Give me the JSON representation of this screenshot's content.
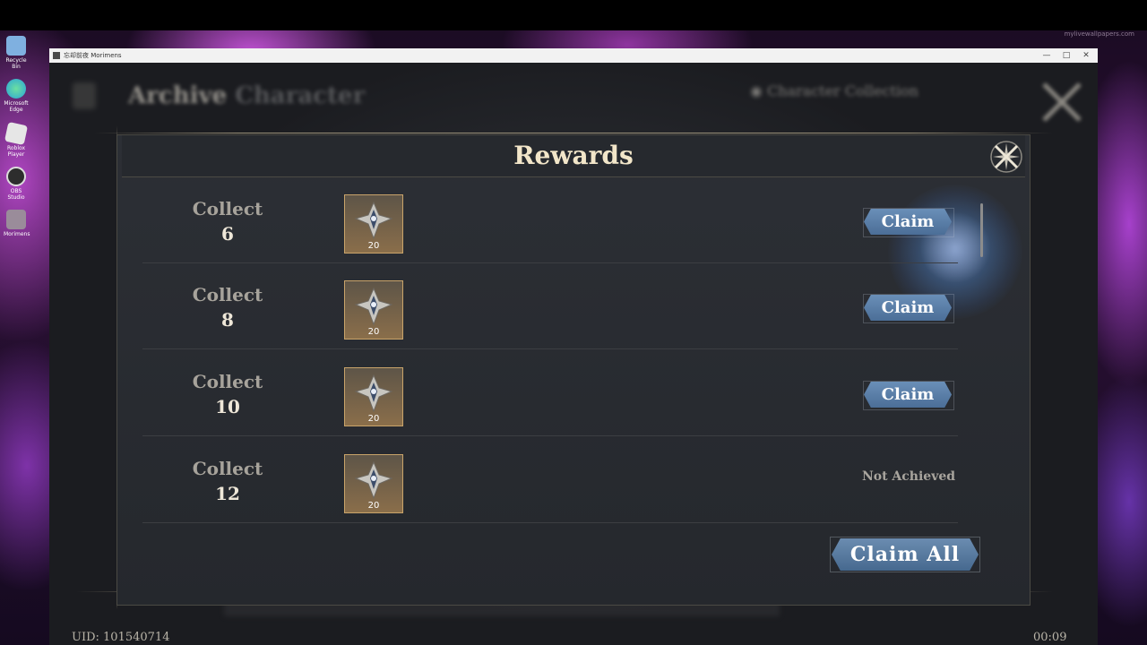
{
  "desktop": {
    "icons": [
      {
        "label": "Recycle Bin",
        "icon": "recycle-bin-icon",
        "color": "#7fb0e0"
      },
      {
        "label": "Microsoft Edge",
        "icon": "edge-icon",
        "color": "#2aa3d8"
      },
      {
        "label": "Roblox Player",
        "icon": "roblox-icon",
        "color": "#e6e6e6"
      },
      {
        "label": "OBS Studio",
        "icon": "obs-icon",
        "color": "#2d2d2d"
      },
      {
        "label": "Morimens",
        "icon": "morimens-icon",
        "color": "#9a8c9a"
      }
    ],
    "watermark": "mylivewallpapers.com"
  },
  "window": {
    "title": "忘却前夜 Morimens",
    "controls": {
      "minimize": "—",
      "maximize": "□",
      "close": "✕"
    }
  },
  "background_ui": {
    "title_main": "Archive",
    "title_sub": "Character",
    "collection_label": "Character Collection"
  },
  "dialog": {
    "title": "Rewards",
    "close_icon": "close-x-icon",
    "rows": [
      {
        "label": "Collect",
        "count": "6",
        "item_qty": "20",
        "action": "Claim",
        "state": "claimable"
      },
      {
        "label": "Collect",
        "count": "8",
        "item_qty": "20",
        "action": "Claim",
        "state": "claimable"
      },
      {
        "label": "Collect",
        "count": "10",
        "item_qty": "20",
        "action": "Claim",
        "state": "claimable"
      },
      {
        "label": "Collect",
        "count": "12",
        "item_qty": "20",
        "action": "Not Achieved",
        "state": "locked"
      }
    ],
    "claim_all": "Claim All"
  },
  "footer": {
    "uid": "UID: 101540714",
    "timer": "00:09"
  },
  "colors": {
    "accent_button": "#5a7ea8",
    "title_text": "#f2e6c9",
    "item_border": "#c9a46a"
  }
}
